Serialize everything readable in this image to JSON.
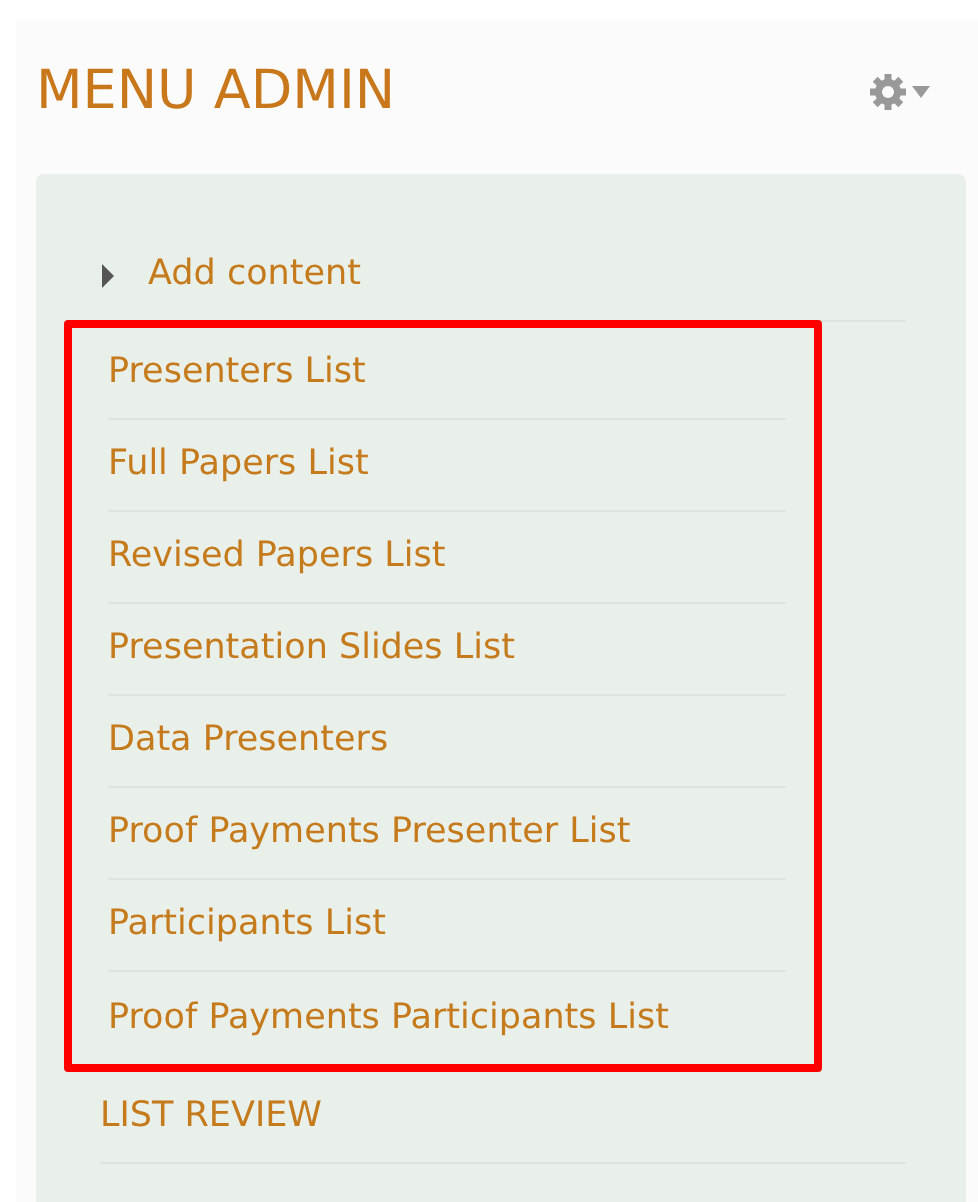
{
  "block": {
    "title": "MENU ADMIN"
  },
  "menu": [
    {
      "label": "Add content",
      "kind": "collapsible",
      "expanded": false
    },
    {
      "kind": "frame",
      "color": "#ff0000",
      "children": [
        {
          "label": "Presenters List"
        },
        {
          "label": "Full Papers List"
        },
        {
          "label": "Revised Papers List"
        },
        {
          "label": "Presentation Slides List"
        },
        {
          "label": "Data Presenters"
        },
        {
          "label": "Proof Payments Presenter List"
        },
        {
          "label": "Participants List"
        },
        {
          "label": "Proof Payments Participants List"
        }
      ]
    },
    {
      "label": "LIST REVIEW",
      "kind": "link"
    }
  ]
}
